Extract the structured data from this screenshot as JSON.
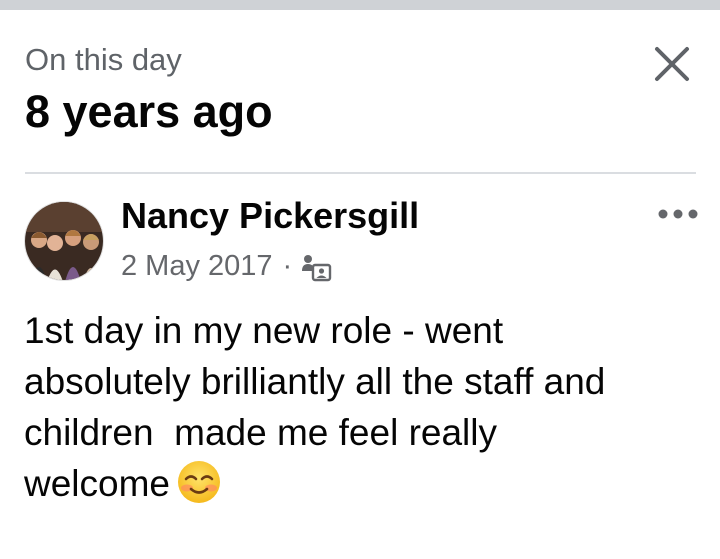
{
  "memory": {
    "subtitle": "On this day",
    "title": "8 years ago"
  },
  "post": {
    "author": "Nancy Pickersgill",
    "date": "2 May 2017",
    "separator": "·",
    "audience_icon": "friends-icon",
    "text_line1": "1st day in my new role - went",
    "text_line2": "absolutely brilliantly all the staff and",
    "text_line3": "children  made me feel really",
    "text_line4": "welcome",
    "emoji": "smiling-face-with-smiling-eyes-emoji"
  },
  "colors": {
    "text_primary": "#050505",
    "text_secondary": "#65676b",
    "divider": "#dadde1",
    "topbar": "#cfd2d6"
  }
}
